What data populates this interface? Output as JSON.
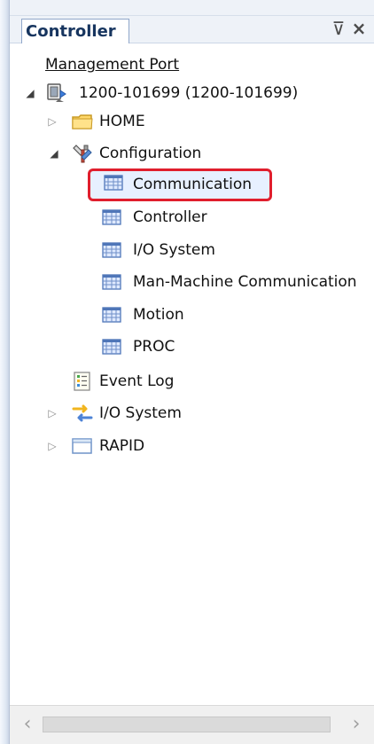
{
  "panel": {
    "tab": {
      "label": "Controller"
    },
    "pin_icon": {
      "glyph": "⊽"
    },
    "close_icon": {
      "glyph": "×"
    }
  },
  "tree": {
    "management_port": "Management Port",
    "controller_node": "1200-101699 (1200-101699)",
    "home": "HOME",
    "configuration": "Configuration",
    "configuration_children": [
      {
        "label": "Communication"
      },
      {
        "label": "Controller"
      },
      {
        "label": "I/O System"
      },
      {
        "label": "Man-Machine Communication"
      },
      {
        "label": "Motion"
      },
      {
        "label": "PROC"
      }
    ],
    "event_log": "Event Log",
    "io_system": "I/O System",
    "rapid": "RAPID"
  },
  "glyphs": {
    "collapsed": "▷",
    "expanded": "◢",
    "scroll_left": "‹",
    "scroll_right": "›"
  },
  "colors": {
    "selection_outline": "#e01e2d",
    "selection_fill": "#e7f0ff",
    "tab_text": "#17355f",
    "panel_border": "#90a7ca",
    "scrollbar": "#f0f0f0"
  }
}
